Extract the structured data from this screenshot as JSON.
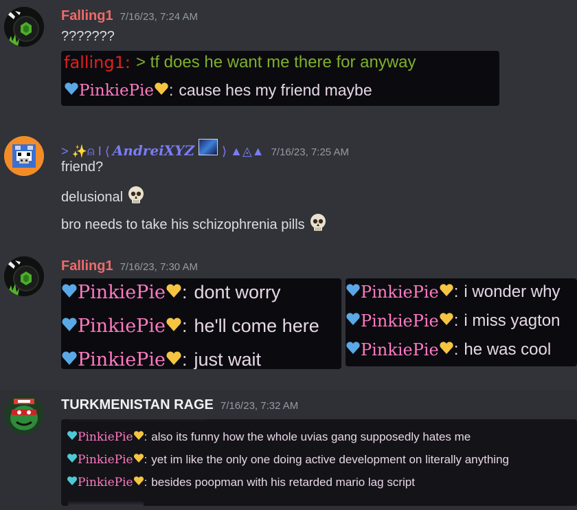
{
  "messages": [
    {
      "username": "Falling1",
      "username_color": "#f06a6a",
      "timestamp": "7/16/23, 7:24 AM",
      "lines": [
        "???????"
      ],
      "embed": {
        "line1_name": "falling1:",
        "line1_text": "> tf does he want me there for anyway",
        "line2_name": "PinkiePie",
        "line2_sep": ":",
        "line2_text": "cause hes my friend maybe"
      }
    },
    {
      "username_prefix": "> ✨⍝ I  ⟨",
      "username": "AndreiXYZ",
      "username_suffix": "⟩ ▲◬▲",
      "username_color": "#7b7cf5",
      "timestamp": "7/16/23, 7:25 AM",
      "lines": [
        "friend?",
        "delusional",
        "bro needs to take his schizophrenia pills"
      ]
    },
    {
      "username": "Falling1",
      "username_color": "#f06a6a",
      "timestamp": "7/16/23, 7:30 AM",
      "embed_left": {
        "name": "PinkiePie",
        "sep": ":",
        "lines": [
          "dont worry",
          "he'll come here",
          "just wait"
        ]
      },
      "embed_right": {
        "name": "PinkiePie",
        "sep": ":",
        "lines": [
          "i wonder why",
          "i miss yagton",
          "he was cool"
        ]
      }
    },
    {
      "username": "TURKMENISTAN RAGE",
      "username_color": "#f2f3f5",
      "timestamp": "7/16/23, 7:32 AM",
      "embed": {
        "name": "PinkiePie",
        "sep": ":",
        "lines": [
          "also its funny how the whole uvias gang supposedly hates me",
          "yet im like the only one doing active development on literally anything",
          "besides poopman with his retarded mario lag script"
        ]
      }
    }
  ],
  "icons": {
    "heart_blue": "#5aa9e6",
    "heart_yellow": "#f5c542",
    "heart_teal": "#4fc8d6"
  }
}
